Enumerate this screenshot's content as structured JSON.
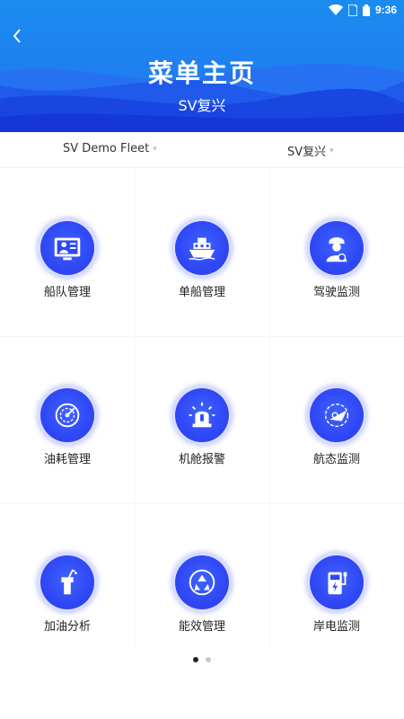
{
  "status_bar": {
    "time": "9:36"
  },
  "header": {
    "title": "菜单主页",
    "subtitle": "SV复兴"
  },
  "selectors": {
    "fleet": "SV Demo Fleet",
    "ship": "SV复兴"
  },
  "menu": [
    {
      "label": "船队管理",
      "icon": "fleet-manager-icon"
    },
    {
      "label": "单船管理",
      "icon": "ship-icon"
    },
    {
      "label": "驾驶监测",
      "icon": "captain-icon"
    },
    {
      "label": "油耗管理",
      "icon": "fuel-gauge-icon"
    },
    {
      "label": "机舱报警",
      "icon": "alarm-icon"
    },
    {
      "label": "航态监测",
      "icon": "radar-icon"
    },
    {
      "label": "加油分析",
      "icon": "fuel-nozzle-icon"
    },
    {
      "label": "能效管理",
      "icon": "recycle-icon"
    },
    {
      "label": "岸电监测",
      "icon": "charging-station-icon"
    }
  ],
  "pager": {
    "pages": 2,
    "current": 1
  },
  "colors": {
    "header_blue": "#1f7ff0",
    "icon_blue": "#2f47f5"
  }
}
